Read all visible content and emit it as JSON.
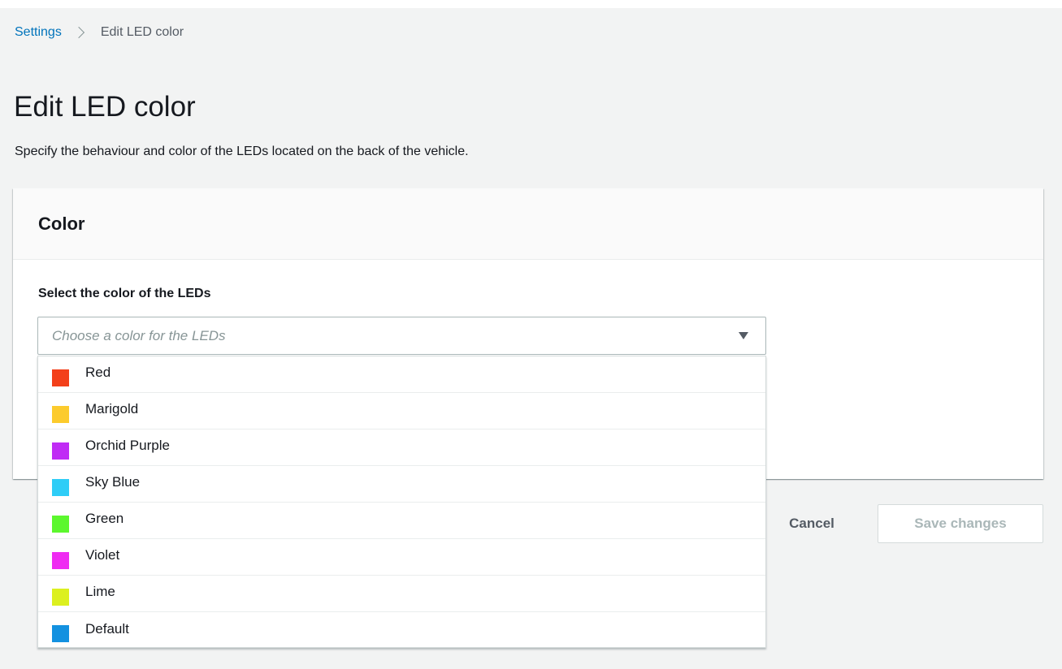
{
  "breadcrumb": {
    "parent_label": "Settings",
    "current_label": "Edit LED color"
  },
  "header": {
    "title": "Edit LED color",
    "description": "Specify the behaviour and color of the LEDs located on the back of the vehicle."
  },
  "card": {
    "title": "Color",
    "field_label": "Select the color of the LEDs",
    "select_placeholder": "Choose a color for the LEDs",
    "options": [
      {
        "label": "Red",
        "color": "#f3401a"
      },
      {
        "label": "Marigold",
        "color": "#fccb2d"
      },
      {
        "label": "Orchid Purple",
        "color": "#c02cf5"
      },
      {
        "label": "Sky Blue",
        "color": "#2ecdf7"
      },
      {
        "label": "Green",
        "color": "#5cf72e"
      },
      {
        "label": "Violet",
        "color": "#ef2bf2"
      },
      {
        "label": "Lime",
        "color": "#dcf01f"
      },
      {
        "label": "Default",
        "color": "#1391e0"
      }
    ]
  },
  "footer": {
    "cancel_label": "Cancel",
    "save_label": "Save changes"
  },
  "colors": {
    "link": "#0073bb",
    "page_background": "#f2f3f3",
    "disabled_text": "#aab7b8"
  }
}
